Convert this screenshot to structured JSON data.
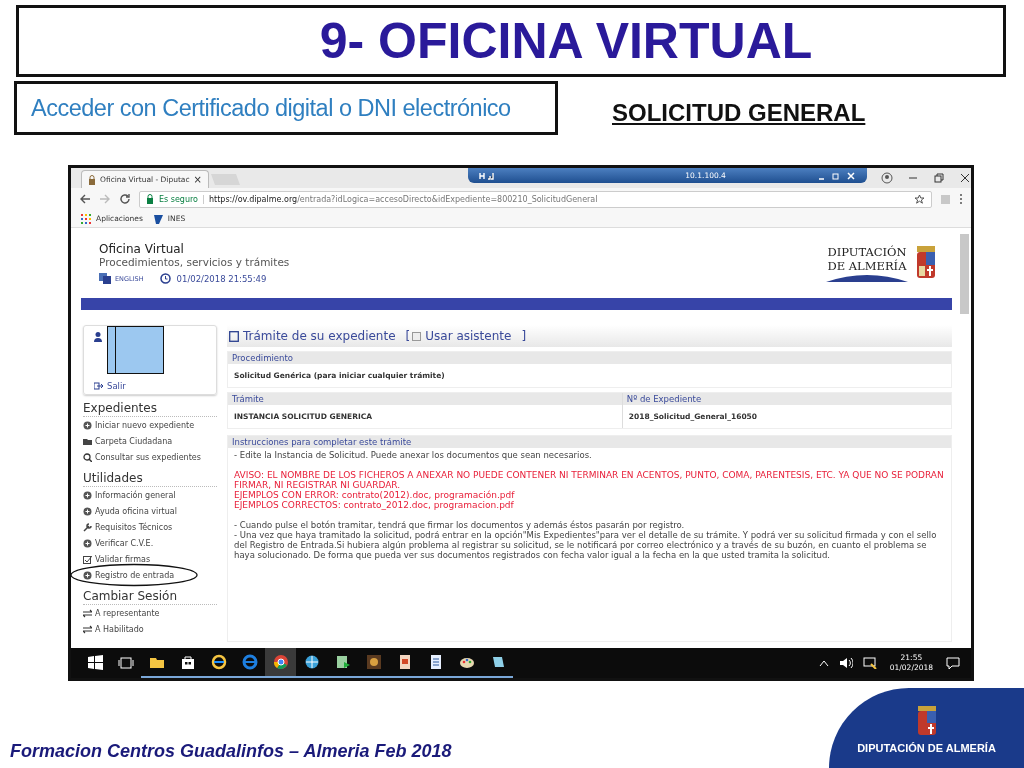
{
  "slide": {
    "title": "9- OFICINA VIRTUAL",
    "subtitle": "Acceder con Certificado digital o DNI electrónico",
    "heading": "SOLICITUD GENERAL",
    "footer": "Formacion Centros Guadalinfos – Almeria Feb 2018",
    "footer_logo": "DIPUTACIÓN DE ALMERÍA"
  },
  "browser": {
    "tab": {
      "title": "Oficina Virtual - Diputac",
      "close": "×"
    },
    "remote_bar": {
      "address": "10.1.100.4"
    },
    "address_bar": {
      "secure_label": "Es seguro",
      "url_host": "https://ov.dipalme.org",
      "url_path": "/entrada?idLogica=accesoDirecto&idExpediente=800210_SolicitudGeneral"
    },
    "bookmarks": [
      "Aplicaciones",
      "INES"
    ]
  },
  "page": {
    "header": {
      "title": "Oficina Virtual",
      "subtitle": "Procedimientos, servicios y trámites",
      "language": "ENGLISH",
      "datetime": "01/02/2018 21:55:49",
      "logo_lines": [
        "DIPUTACIÓN",
        "DE ALMERÍA"
      ]
    },
    "sidebar": {
      "logout": "Salir",
      "sections": [
        {
          "title": "Expedientes",
          "items": [
            {
              "label": "Iniciar nuevo expediente",
              "circled": false
            },
            {
              "label": "Carpeta Ciudadana",
              "circled": false
            },
            {
              "label": "Consultar sus expedientes",
              "circled": false
            }
          ]
        },
        {
          "title": "Utilidades",
          "items": [
            {
              "label": "Información general",
              "circled": false
            },
            {
              "label": "Ayuda oficina virtual",
              "circled": false
            },
            {
              "label": "Requisitos Técnicos",
              "circled": false
            },
            {
              "label": "Verificar C.V.E.",
              "circled": false
            },
            {
              "label": "Validar firmas",
              "circled": false
            },
            {
              "label": "Registro de entrada",
              "circled": true
            }
          ]
        },
        {
          "title": "Cambiar Sesión",
          "items": [
            {
              "label": "A representante",
              "circled": false
            },
            {
              "label": "A Habilitado",
              "circled": false
            }
          ]
        }
      ]
    },
    "main": {
      "heading": "Trámite de su expediente",
      "assistant": {
        "open": "[",
        "label": "Usar asistente",
        "close": "]",
        "checked": false
      },
      "panels": [
        {
          "columns": [
            {
              "label": "Procedimiento",
              "value": "Solicitud Genérica (para iniciar cualquier trámite)"
            }
          ]
        },
        {
          "columns": [
            {
              "label": "Trámite",
              "value": "INSTANCIA SOLICITUD GENERICA"
            },
            {
              "label": "Nº de Expediente",
              "value": "2018_Solicitud_General_16050"
            }
          ]
        }
      ],
      "instructions": {
        "label": "Instrucciones para completar este trámite",
        "blocks": [
          {
            "kind": "normal",
            "lines": [
              "- Edite la Instancia de Solicitud. Puede anexar los documentos que sean necesarios."
            ]
          },
          {
            "kind": "warning",
            "lines": [
              "AVISO: EL NOMBRE DE LOS FICHEROS A ANEXAR NO PUEDE CONTENER NI TERMINAR EN ACENTOS, PUNTO, COMA, PARENTESIS, ETC. YA QUE NO SE PODRAN FIRMAR, NI REGISTRAR NI GUARDAR.",
              "EJEMPLOS CON ERROR:  contrato(2012).doc, programación.pdf",
              "EJEMPLOS CORRECTOS: contrato_2012.doc, programacion.pdf"
            ]
          },
          {
            "kind": "normal",
            "lines": [
              "- Cuando pulse el botón tramitar, tendrá que firmar los documentos y además éstos pasarán por registro.",
              "- Una vez que haya tramitado la solicitud, podrá entrar en la opción\"Mis Expedientes\"para ver el detalle de su trámite. Y podrá ver su solicitud firmada y con el sello del Registro de Entrada.Si hubiera algún problema al registrar su solicitud, se le notificará por correo electrónico y a través de su buzón, en cuanto el problema se haya solucionado. De forma que pueda ver sus documentos registrados con fecha valor igual a la fecha en la que usted tramita la solicitud."
            ]
          }
        ]
      }
    }
  },
  "taskbar": {
    "time": "21:55",
    "date": "01/02/2018"
  }
}
